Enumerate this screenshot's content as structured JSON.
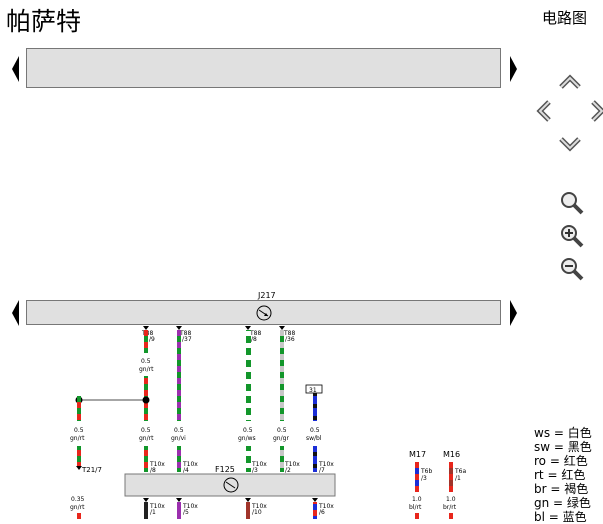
{
  "header": {
    "title": "帕萨特",
    "subtitle": "电路图"
  },
  "components": {
    "module_top": "J217",
    "module_bottom": "F125",
    "relay": "31",
    "motor_1": "M17",
    "motor_2": "M16",
    "connector_t21": "T21/7"
  },
  "connectors": {
    "t88_9": "T88",
    "t88_9_pin": "/9",
    "t88_37": "T88",
    "t88_37_pin": "/37",
    "t88_8": "T88",
    "t88_8_pin": "/8",
    "t88_36": "T88",
    "t88_36_pin": "/36",
    "t10x_8": "T10x",
    "t10x_8_pin": "/8",
    "t10x_4": "T10x",
    "t10x_4_pin": "/4",
    "t10x_3": "T10x",
    "t10x_3_pin": "/3",
    "t10x_2": "T10x",
    "t10x_2_pin": "/2",
    "t10x_7": "T10x",
    "t10x_7_pin": "/7",
    "t10x_1": "T10x",
    "t10x_1_pin": "/1",
    "t10x_5": "T10x",
    "t10x_5_pin": "/5",
    "t10x_10": "T10x",
    "t10x_10_pin": "/10",
    "t10x_6": "T10x",
    "t10x_6_pin": "/6",
    "t6b": "T6b",
    "t6b_pin": "/3",
    "t6a": "T6a",
    "t6a_pin": "/1"
  },
  "wires": {
    "w1_size": "0.5",
    "w1_color": "gn/rt",
    "w2_size": "0.5",
    "w2_color": "gn/rt",
    "w3_size": "0.5",
    "w3_color": "gn/rt",
    "w4_size": "0.5",
    "w4_color": "gn/vi",
    "w5_size": "0.5",
    "w5_color": "gn/ws",
    "w6_size": "0.5",
    "w6_color": "gn/gr",
    "w7_size": "0.5",
    "w7_color": "sw/bl",
    "w8_size": "0.35",
    "w8_color": "gn/rt",
    "w9_size": "1.0",
    "w9_color": "bl/rt",
    "w10_size": "1.0",
    "w10_color": "br/rt"
  },
  "legend": [
    {
      "code": "ws",
      "meaning": "白色"
    },
    {
      "code": "sw",
      "meaning": "黑色"
    },
    {
      "code": "ro",
      "meaning": "红色"
    },
    {
      "code": "rt",
      "meaning": "红色"
    },
    {
      "code": "br",
      "meaning": "褐色"
    },
    {
      "code": "gn",
      "meaning": "绿色"
    },
    {
      "code": "bl",
      "meaning": "蓝色"
    }
  ],
  "colors": {
    "bar_bg": "#e0e0e0",
    "red": "#e8261c",
    "green": "#12962a",
    "purple": "#9b2fae",
    "blue": "#1b2ed6",
    "brown": "#a0342a"
  }
}
